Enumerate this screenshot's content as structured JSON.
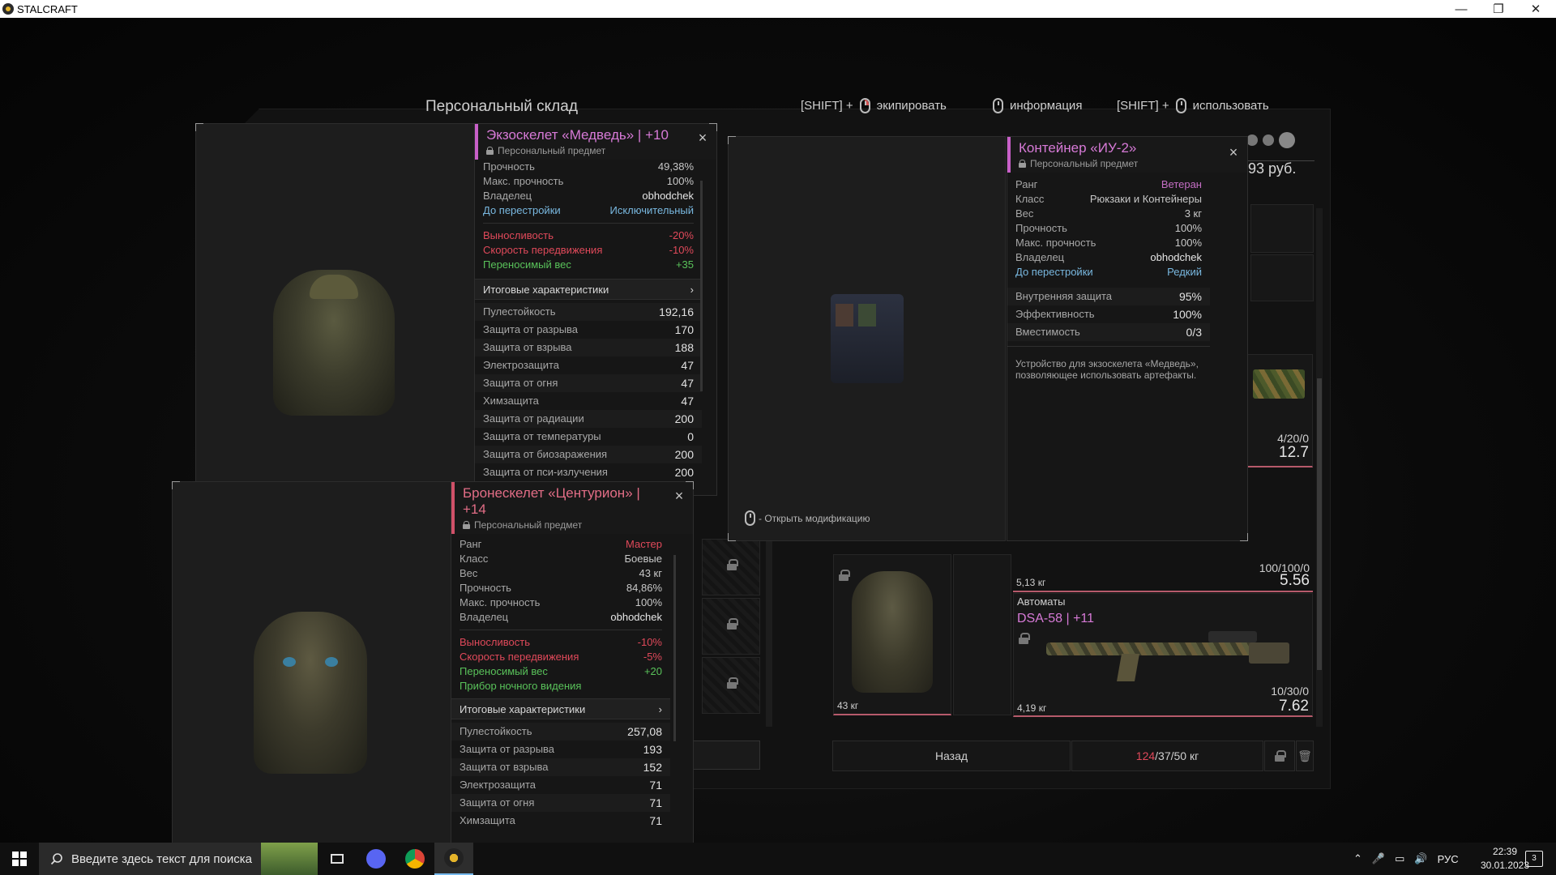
{
  "window": {
    "title": "STALCRAFT",
    "minimize": "—",
    "maximize": "❐",
    "close": "✕"
  },
  "storage": {
    "title": "Персональный склад",
    "hints": [
      {
        "prefix": "[SHIFT] +",
        "label": "экипировать"
      },
      {
        "prefix": "",
        "label": "информация"
      },
      {
        "prefix": "[SHIFT] +",
        "label": "использовать"
      }
    ],
    "balance": "93 руб.",
    "back_button": "Назад",
    "weight": {
      "current": "124",
      "rest": "/37/50 кг"
    }
  },
  "exo": {
    "title": "Экзоскелет «Медведь» | +10",
    "subtitle": "Персональный предмет",
    "info": [
      {
        "k": "Прочность",
        "v": "49,38%"
      },
      {
        "k": "Макс. прочность",
        "v": "100%"
      },
      {
        "k": "Владелец",
        "v": "obhodchek"
      },
      {
        "k": "До перестройки",
        "v": "Исключительный"
      }
    ],
    "effects": [
      {
        "k": "Выносливость",
        "v": "-20%"
      },
      {
        "k": "Скорость передвижения",
        "v": "-10%"
      },
      {
        "k": "Переносимый вес",
        "v": "+35"
      }
    ],
    "summary_label": "Итоговые характеристики",
    "stats": [
      {
        "k": "Пулестойкость",
        "v": "192,16"
      },
      {
        "k": "Защита от разрыва",
        "v": "170"
      },
      {
        "k": "Защита от взрыва",
        "v": "188"
      },
      {
        "k": "Электрозащита",
        "v": "47"
      },
      {
        "k": "Защита от огня",
        "v": "47"
      },
      {
        "k": "Химзащита",
        "v": "47"
      },
      {
        "k": "Защита от радиации",
        "v": "200"
      },
      {
        "k": "Защита от температуры",
        "v": "0"
      },
      {
        "k": "Защита от биозаражения",
        "v": "200"
      },
      {
        "k": "Защита от пси-излучения",
        "v": "200"
      }
    ]
  },
  "armor": {
    "title": "Бронескелет «Центурион» | +14",
    "subtitle": "Персональный предмет",
    "info": [
      {
        "k": "Ранг",
        "v": "Мастер"
      },
      {
        "k": "Класс",
        "v": "Боевые"
      },
      {
        "k": "Вес",
        "v": "43 кг"
      },
      {
        "k": "Прочность",
        "v": "84,86%"
      },
      {
        "k": "Макс. прочность",
        "v": "100%"
      },
      {
        "k": "Владелец",
        "v": "obhodchek"
      }
    ],
    "effects": [
      {
        "k": "Выносливость",
        "v": "-10%"
      },
      {
        "k": "Скорость передвижения",
        "v": "-5%"
      },
      {
        "k": "Переносимый вес",
        "v": "+20"
      },
      {
        "k": "Прибор ночного видения",
        "v": ""
      }
    ],
    "summary_label": "Итоговые характеристики",
    "stats": [
      {
        "k": "Пулестойкость",
        "v": "257,08"
      },
      {
        "k": "Защита от разрыва",
        "v": "193"
      },
      {
        "k": "Защита от взрыва",
        "v": "152"
      },
      {
        "k": "Электрозащита",
        "v": "71"
      },
      {
        "k": "Защита от огня",
        "v": "71"
      },
      {
        "k": "Химзащита",
        "v": "71"
      }
    ]
  },
  "container": {
    "title": "Контейнер «ИУ-2»",
    "subtitle": "Персональный предмет",
    "info": [
      {
        "k": "Ранг",
        "v": "Ветеран"
      },
      {
        "k": "Класс",
        "v": "Рюкзаки и Контейнеры"
      },
      {
        "k": "Вес",
        "v": "3 кг"
      },
      {
        "k": "Прочность",
        "v": "100%"
      },
      {
        "k": "Макс. прочность",
        "v": "100%"
      },
      {
        "k": "Владелец",
        "v": "obhodchek"
      },
      {
        "k": "До перестройки",
        "v": "Редкий"
      }
    ],
    "stats": [
      {
        "k": "Внутренняя защита",
        "v": "95%"
      },
      {
        "k": "Эффективность",
        "v": "100%"
      },
      {
        "k": "Вместимость",
        "v": "0/3"
      }
    ],
    "description": "Устройство для экзоскелета «Медведь», позволяющее использовать артефакты.",
    "open_mods": "- Открыть модификацию"
  },
  "inventory": {
    "ammo_a": {
      "count": "4/20/0",
      "caliber": "12.7"
    },
    "ammo_b": {
      "count": "100/100/0",
      "caliber": "5.56",
      "weight": "5,13 кг"
    },
    "rifle": {
      "category": "Автоматы",
      "name": "DSA-58 | +11",
      "count": "10/30/0",
      "caliber": "7.62",
      "weight": "4,19 кг"
    },
    "armor_cell": {
      "weight": "43 кг"
    }
  },
  "taskbar": {
    "search_placeholder": "Введите здесь текст для поиска",
    "lang": "РУС",
    "time": "22:39",
    "date": "30.01.2023",
    "notifications": "3"
  }
}
